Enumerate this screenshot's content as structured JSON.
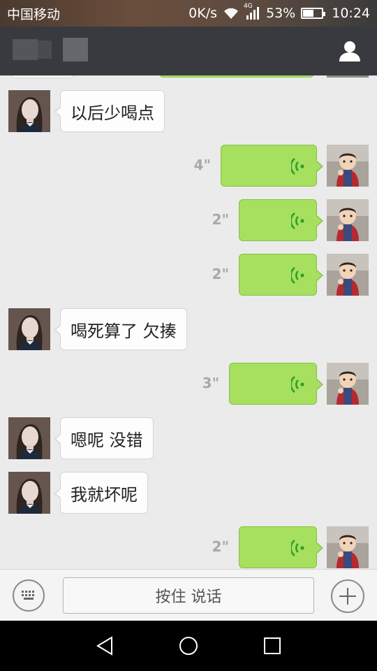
{
  "status_bar": {
    "carrier": "中国移动",
    "speed": "0K/s",
    "network": "4G",
    "battery": "53%",
    "battery_level": 0.53,
    "time": "10:24"
  },
  "title_bar": {
    "contact_icon": "person-icon"
  },
  "colors": {
    "sent_bubble": "#a6e05e",
    "received_bubble": "#fdfdfd",
    "titlebar": "#393a3f",
    "chat_bg": "#ebebeb"
  },
  "messages": [
    {
      "side": "left",
      "type": "text",
      "text": "以后少喝点"
    },
    {
      "side": "right",
      "type": "voice",
      "duration": "4\""
    },
    {
      "side": "right",
      "type": "voice",
      "duration": "2\""
    },
    {
      "side": "right",
      "type": "voice",
      "duration": "2\""
    },
    {
      "side": "left",
      "type": "text",
      "text": "喝死算了 欠揍"
    },
    {
      "side": "right",
      "type": "voice",
      "duration": "3\""
    },
    {
      "side": "left",
      "type": "text",
      "text": "嗯呢 没错"
    },
    {
      "side": "left",
      "type": "text",
      "text": "我就坏呢"
    },
    {
      "side": "right",
      "type": "voice",
      "duration": "2\""
    }
  ],
  "input_bar": {
    "talk_label": "按住 说话",
    "keyboard_icon": "keyboard-icon",
    "plus_icon": "plus-icon"
  },
  "nav_bar": {
    "back_icon": "back-triangle-icon",
    "home_icon": "home-circle-icon",
    "recents_icon": "recents-square-icon"
  }
}
